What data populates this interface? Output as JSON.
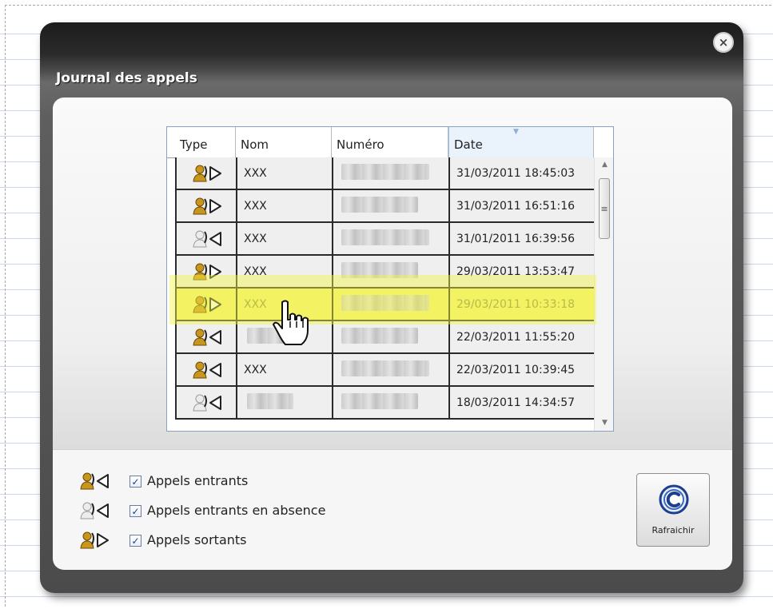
{
  "window": {
    "title": "Journal des appels",
    "close_glyph": "×"
  },
  "grid": {
    "columns": [
      "Type",
      "Nom",
      "Numéro",
      "Date"
    ],
    "rows": [
      {
        "type": "outgoing",
        "nom": "XXX",
        "numero_hidden": true,
        "date": "31/03/2011 18:45:03"
      },
      {
        "type": "outgoing",
        "nom": "XXX",
        "numero_hidden": true,
        "date": "31/03/2011 16:51:16"
      },
      {
        "type": "missed",
        "nom": "XXX",
        "numero_hidden": true,
        "date": "31/01/2011 16:39:56"
      },
      {
        "type": "outgoing",
        "nom": "XXX",
        "numero_hidden": true,
        "date": "29/03/2011 13:53:47"
      },
      {
        "type": "outgoing",
        "nom": "XXX",
        "numero_hidden": true,
        "date": "29/03/2011 10:33:18",
        "selected": true
      },
      {
        "type": "incoming",
        "nom": "",
        "nom_hidden": true,
        "numero_hidden": true,
        "date": "22/03/2011 11:55:20"
      },
      {
        "type": "incoming",
        "nom": "XXX",
        "numero_hidden": true,
        "date": "22/03/2011 10:39:45"
      },
      {
        "type": "missed",
        "nom": "",
        "nom_hidden": true,
        "numero_hidden": true,
        "date": "18/03/2011 14:34:57"
      }
    ],
    "scroll_grip": "≡",
    "scroll_up": "▲",
    "scroll_down": "▼"
  },
  "legend": [
    {
      "type": "incoming",
      "label": "Appels entrants",
      "checked": true
    },
    {
      "type": "missed",
      "label": "Appels entrants en absence",
      "checked": true
    },
    {
      "type": "outgoing",
      "label": "Appels sortants",
      "checked": true
    }
  ],
  "check_glyph": "✓",
  "refresh": {
    "label": "Rafraichir"
  },
  "colors": {
    "selected_row": "#f0f07a",
    "dialog_dark": "#1c1c1c",
    "icon_person": "#c8951d",
    "icon_missed": "#e8e8e8"
  }
}
